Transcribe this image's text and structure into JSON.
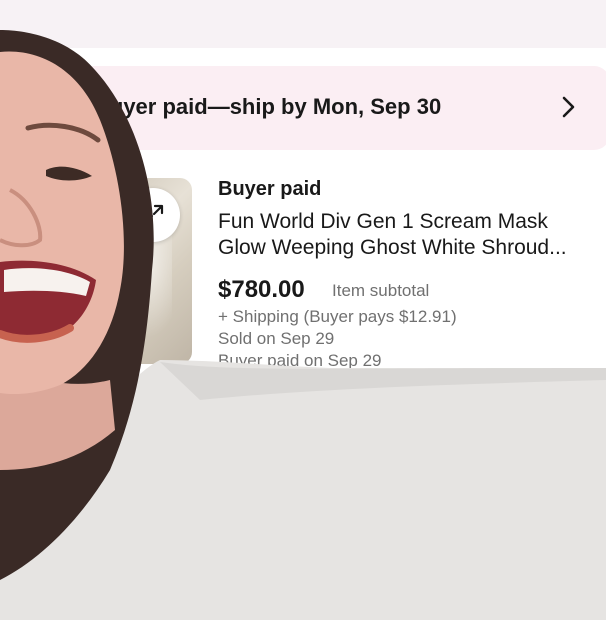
{
  "banner": {
    "text": "Buyer paid—ship by Mon, Sep 30",
    "chevron_icon": "chevron-right-icon"
  },
  "order": {
    "status": "Buyer paid",
    "title_line_1": "Fun World Div Gen 1 Scream Mask",
    "title_line_2": "Glow Weeping Ghost White Shroud...",
    "price": "$780.00",
    "price_label": "Item subtotal",
    "shipping": "+ Shipping (Buyer pays $12.91)",
    "sold_date": "Sold on Sep 29",
    "paid_date": "Buyer paid on Sep 29",
    "expand_icon": "expand-icon"
  },
  "colors": {
    "banner_bg": "#fbeef3",
    "text_primary": "#191919",
    "text_secondary": "#707070",
    "sweater": "#e6e4e2"
  }
}
